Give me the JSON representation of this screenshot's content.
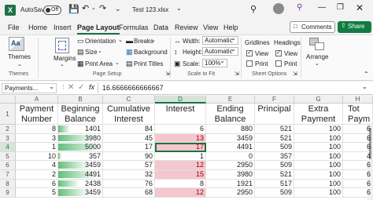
{
  "titlebar": {
    "autosave_label": "AutoSave",
    "autosave_state": "Off",
    "filename": "Test 123.xlsx"
  },
  "menu": {
    "items": [
      "File",
      "Home",
      "Insert",
      "Page Layout",
      "Formulas",
      "Data",
      "Review",
      "View",
      "Help"
    ],
    "active": "Page Layout",
    "comments_label": "Comments",
    "share_label": "Share"
  },
  "ribbon": {
    "themes": {
      "label": "Themes",
      "group": "Themes"
    },
    "page_setup": {
      "margins": "Margins",
      "orientation": "Orientation",
      "size": "Size",
      "print_area": "Print Area",
      "breaks": "Breaks",
      "background": "Background",
      "print_titles": "Print Titles",
      "group": "Page Setup"
    },
    "scale_to_fit": {
      "width_label": "Width:",
      "width_value": "Automatic",
      "height_label": "Height:",
      "height_value": "Automatic",
      "scale_label": "Scale:",
      "scale_value": "100%",
      "group": "Scale to Fit"
    },
    "sheet_options": {
      "gridlines": "Gridlines",
      "headings": "Headings",
      "view": "View",
      "print": "Print",
      "group": "Sheet Options"
    },
    "arrange": {
      "label": "Arrange"
    }
  },
  "formula_bar": {
    "name_box": "Payments...",
    "fx": "fx",
    "value": "16.6666666666667"
  },
  "sheet": {
    "columns": [
      "A",
      "B",
      "C",
      "D",
      "E",
      "F",
      "G",
      "H"
    ],
    "headers": [
      [
        "Payment",
        "Number"
      ],
      [
        "Beginning",
        "Balance"
      ],
      [
        "Cumulative",
        "Interest"
      ],
      [
        "Interest",
        ""
      ],
      [
        "Ending",
        "Balance"
      ],
      [
        "Principal",
        ""
      ],
      [
        "Extra",
        "Payment"
      ],
      [
        "Tot",
        "Paym"
      ]
    ],
    "rows": [
      {
        "n": "2",
        "cells": [
          "8",
          "1401",
          "84",
          "6",
          "880",
          "521",
          "100",
          "6"
        ]
      },
      {
        "n": "3",
        "cells": [
          "3",
          "3980",
          "45",
          "13",
          "3459",
          "521",
          "100",
          "6"
        ]
      },
      {
        "n": "4",
        "cells": [
          "1",
          "5000",
          "17",
          "17",
          "4491",
          "509",
          "100",
          "6"
        ]
      },
      {
        "n": "5",
        "cells": [
          "10",
          "357",
          "90",
          "1",
          "0",
          "357",
          "100",
          "4"
        ]
      },
      {
        "n": "6",
        "cells": [
          "4",
          "3459",
          "57",
          "12",
          "2950",
          "509",
          "100",
          "6"
        ]
      },
      {
        "n": "7",
        "cells": [
          "2",
          "4491",
          "32",
          "15",
          "3980",
          "521",
          "100",
          "6"
        ]
      },
      {
        "n": "8",
        "cells": [
          "6",
          "2438",
          "76",
          "8",
          "1921",
          "517",
          "100",
          "6"
        ]
      },
      {
        "n": "9",
        "cells": [
          "5",
          "3459",
          "68",
          "12",
          "2950",
          "509",
          "100",
          "6"
        ]
      }
    ],
    "databar_fraction_B": [
      0.28,
      0.8,
      1.0,
      0.07,
      0.69,
      0.9,
      0.49,
      0.69
    ],
    "highlight_D": [
      false,
      true,
      true,
      false,
      true,
      true,
      false,
      true
    ],
    "colors": {
      "accent": "#1e7145",
      "databar": "#63be7b",
      "highlight": "#f4c7ce",
      "share": "#107c41"
    }
  }
}
